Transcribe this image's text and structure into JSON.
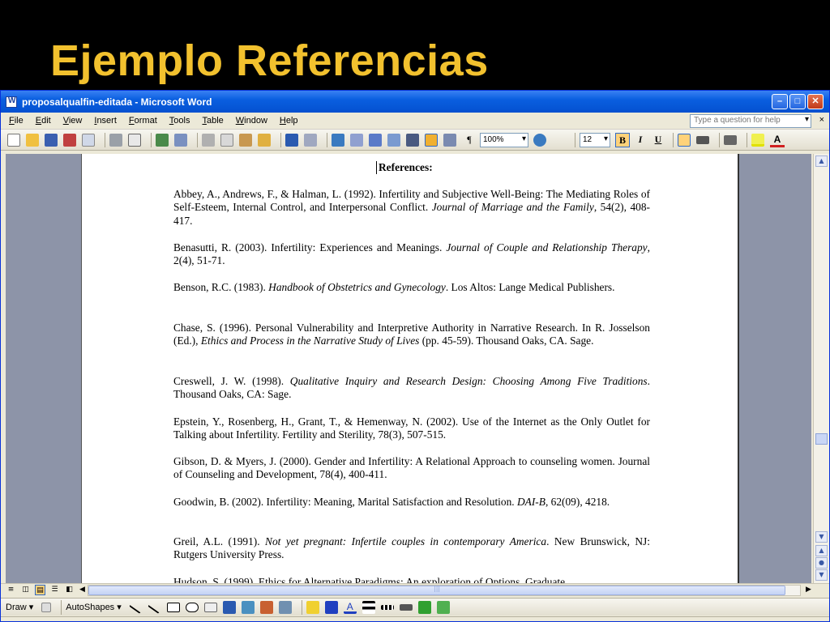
{
  "slide": {
    "title": "Ejemplo Referencias"
  },
  "window": {
    "title": "proposalqualfin-editada - Microsoft Word",
    "minimize": "–",
    "maximize": "□",
    "close": "✕"
  },
  "menu": {
    "items": [
      "File",
      "Edit",
      "View",
      "Insert",
      "Format",
      "Tools",
      "Table",
      "Window",
      "Help"
    ],
    "help_placeholder": "Type a question for help",
    "close_doc": "×"
  },
  "toolbar": {
    "zoom": "100%",
    "font_size": "12",
    "bold": "B",
    "italic": "I",
    "underline": "U",
    "pilcrow": "¶",
    "font_color_letter": "A"
  },
  "document": {
    "heading": "References:",
    "references": [
      {
        "plain": "Abbey, A., Andrews, F., & Halman, L. (1992).  Infertility and Subjective Well-Being: The Mediating Roles of Self-Esteem, Internal Control, and Interpersonal Conflict. ",
        "title": "Journal of Marriage and the Family",
        "tail": ", 54(2), 408-417."
      },
      {
        "plain": "Benasutti, R. (2003).  Infertility: Experiences and Meanings.  ",
        "title": "Journal of Couple and Relationship Therapy",
        "tail": ", 2(4), 51-71."
      },
      {
        "plain": "Benson, R.C. (1983). ",
        "title": "Handbook of Obstetrics and Gynecology",
        "tail": ". Los Altos: Lange Medical Publishers."
      },
      {
        "plain": "Chase, S. (1996).  Personal Vulnerability and Interpretive Authority in Narrative Research. In R. Josselson (Ed.), ",
        "title": "Ethics and Process in the Narrative Study of Lives",
        "tail": " (pp. 45-59). Thousand Oaks, CA. Sage."
      },
      {
        "plain": "Creswell, J. W. (1998). ",
        "title": "Qualitative Inquiry and Research Design: Choosing Among Five Traditions",
        "tail": ". Thousand Oaks, CA: Sage."
      },
      {
        "plain": "Epstein, Y., Rosenberg, H., Grant, T., & Hemenway, N. (2002).  Use of the Internet as the Only Outlet for Talking about Infertility. Fertility and Sterility, 78(3), 507-515.",
        "title": "",
        "tail": ""
      },
      {
        "plain": "Gibson, D. & Myers, J. (2000).  Gender and Infertility: A Relational Approach to counseling women. Journal of Counseling and Development, 78(4), 400-411.",
        "title": "",
        "tail": ""
      },
      {
        "plain": "Goodwin, B. (2002).  Infertility: Meaning, Marital Satisfaction and Resolution.  ",
        "title": "DAI-B",
        "tail": ", 62(09), 4218."
      },
      {
        "plain": "Greil, A.L. (1991).  ",
        "title": "Not yet pregnant: Infertile couples in contemporary America",
        "tail": ".  New Brunswick, NJ: Rutgers University Press."
      },
      {
        "plain": "Hudson, S. (1999).  Ethics for Alternative Paradigms: An exploration of Options. Graduate",
        "title": "",
        "tail": ""
      }
    ]
  },
  "drawbar": {
    "draw": "Draw ▾",
    "autoshapes": "AutoShapes ▾"
  }
}
